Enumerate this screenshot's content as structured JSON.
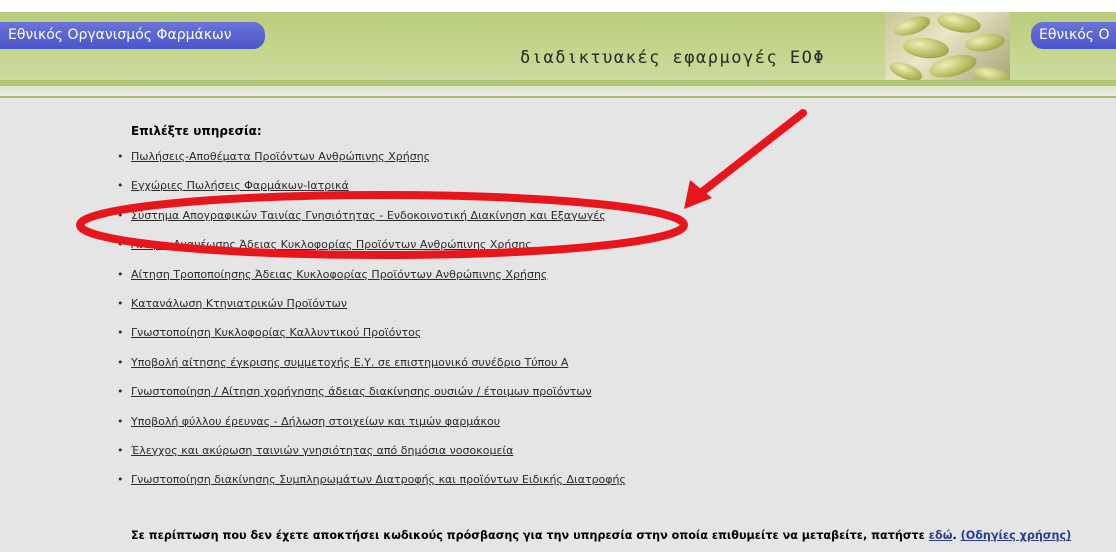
{
  "header": {
    "org_name": "Εθνικός Οργανισμός Φαρμάκων",
    "org_name_right": "Εθνικός Ο",
    "title": "διαδικτυακές εφαρμογές ΕΟΦ",
    "image_icon": "pills-image"
  },
  "services": {
    "heading": "Επιλέξτε υπηρεσία:",
    "items": [
      "Πωλήσεις-Αποθέματα Προϊόντων Ανθρώπινης Χρήσης",
      "Εγχώριες Πωλήσεις Φαρμάκων-Ιατρικά",
      "Σύστημα Απογραφικών Ταινίας Γνησιότητας - Ενδοκοινοτική Διακίνηση και Εξαγωγές",
      "Αίτηση Ανανέωσης Άδειας Κυκλοφορίας Προϊόντων Ανθρώπινης Χρήσης",
      "Αίτηση Τροποποίησης Άδειας Κυκλοφορίας Προϊόντων Ανθρώπινης Χρήσης",
      "Κατανάλωση Κτηνιατρικών Προϊόντων",
      "Γνωστοποίηση Κυκλοφορίας Καλλυντικού Προϊόντος",
      "Υποβολή αίτησης έγκρισης συμμετοχής Ε.Υ. σε επιστημονικό συνέδριο Τύπου Α",
      "Γνωστοποίηση / Αίτηση χορήγησης άδειας διακίνησης ουσιών / έτοιμων προϊόντων",
      "Υποβολή φύλλου έρευνας - Δήλωση στοιχείων και τιμών φαρμάκου",
      "Έλεγχος και ακύρωση ταινιών γνησιότητας από δημόσια νοσοκομεία",
      "Γνωστοποίηση διακίνησης Συμπληρωμάτων Διατροφής και προϊόντων Ειδικής Διατροφής"
    ],
    "bullet": "•"
  },
  "footer": {
    "text": "Σε περίπτωση που δεν έχετε αποκτήσει κωδικούς πρόσβασης για την υπηρεσία στην οποία επιθυμείτε να μεταβείτε, πατήστε ",
    "here_link": "εδώ",
    "separator": ". ",
    "instructions_link": "(Οδηγίες χρήσης)"
  },
  "annotation": {
    "color": "#e8161c",
    "highlighted_item_index": 2
  }
}
